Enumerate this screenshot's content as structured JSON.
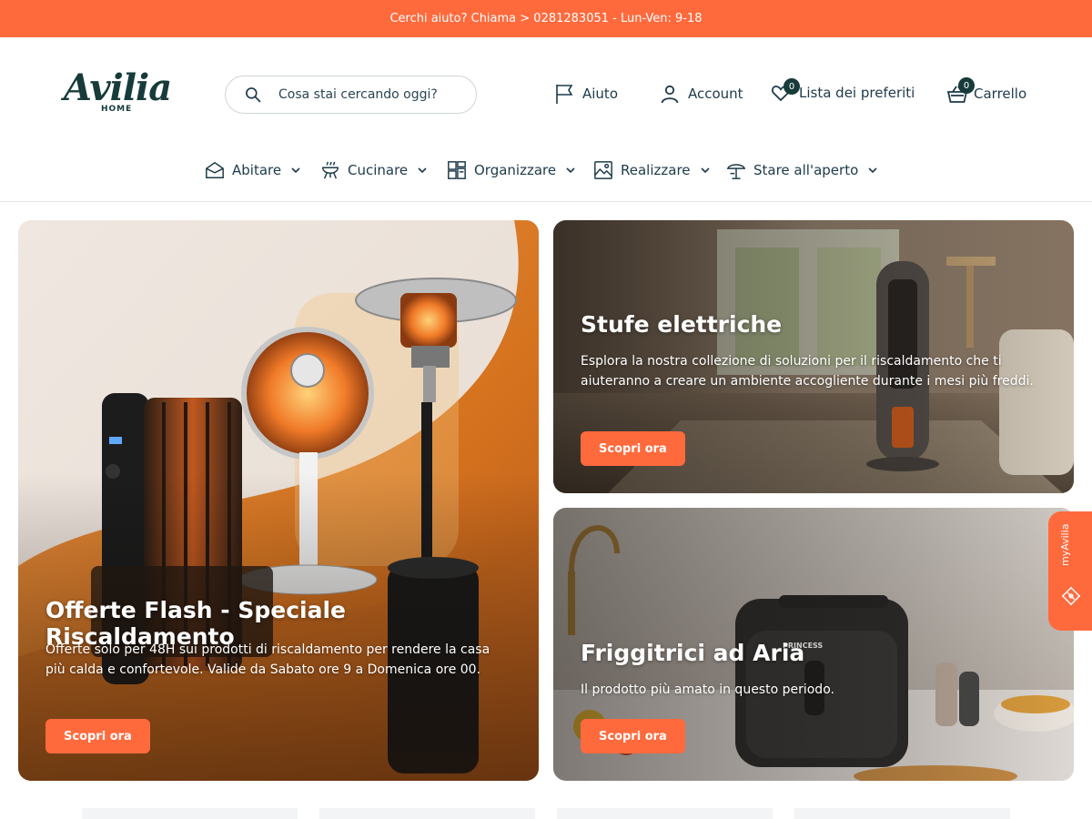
{
  "topbar": {
    "text": "Cerchi aiuto? Chiama > 0281283051 - Lun-Ven: 9-18"
  },
  "header": {
    "logo": {
      "word": "Avilia",
      "sub": "HOME"
    },
    "search": {
      "placeholder": "Cosa stai cercando oggi?",
      "icon": "search-icon"
    },
    "links": {
      "help": "Aiuto",
      "account": "Account",
      "wishlist": "Lista dei preferiti",
      "wishlist_count": "0",
      "cart": "Carrello",
      "cart_count": "0"
    }
  },
  "nav": {
    "items": [
      {
        "label": "Abitare",
        "icon": "house-icon"
      },
      {
        "label": "Cucinare",
        "icon": "grill-icon"
      },
      {
        "label": "Organizzare",
        "icon": "shelves-icon"
      },
      {
        "label": "Realizzare",
        "icon": "picture-icon"
      },
      {
        "label": "Stare all'aperto",
        "icon": "parasol-icon"
      }
    ]
  },
  "hero": {
    "main": {
      "title": "Offerte Flash - Speciale Riscaldamento",
      "description": "Offerte solo per 48H sui prodotti di riscaldamento per rendere la casa più calda e confortevole. Valide da Sabato ore 9 a Domenica ore 00.",
      "cta": "Scopri ora"
    },
    "top_right": {
      "title": "Stufe elettriche",
      "description": "Esplora la nostra collezione di soluzioni per il riscaldamento che ti aiuteranno a creare un ambiente accogliente durante i mesi più freddi.",
      "cta": "Scopri ora"
    },
    "bottom_right": {
      "title": "Friggitrici ad Aria",
      "description": "Il prodotto più amato in questo periodo.",
      "cta": "Scopri ora",
      "brand_mark": "PRINCESS"
    }
  },
  "sidetab": {
    "label": "myAvilia",
    "icon": "ticket-icon"
  },
  "colors": {
    "accent": "#ff6a3d",
    "brand": "#173b3b",
    "text": "#1d3a4a"
  }
}
